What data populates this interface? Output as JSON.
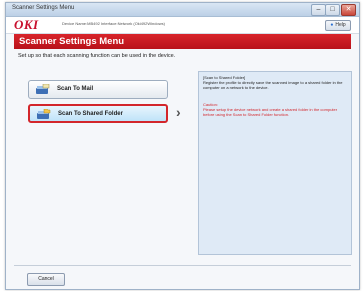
{
  "window": {
    "title": "Scanner Settings Menu",
    "minimize_glyph": "–",
    "maximize_glyph": "□",
    "close_glyph": "✕"
  },
  "header": {
    "logo": "OKI",
    "device_name": "Device Name:MB492 Interface:Network (Oki492Windows)",
    "help_label": "Help",
    "help_icon": "help-icon"
  },
  "menu_title": "Scanner Settings Menu",
  "intro": "Set up so that each scanning function can be used in the device.",
  "buttons": [
    {
      "label": "Scan To Mail",
      "icon": "scanner-mail-icon"
    },
    {
      "label": "Scan To Shared Folder",
      "icon": "scanner-folder-icon"
    }
  ],
  "arrow_glyph": "›",
  "info": {
    "title": "[Scan to Shared Folder]",
    "description": "Register the profile to directly save the scanned image to a shared folder in the computer on a network to the device.",
    "caution_label": "Caution:",
    "caution_text": "Please setup the device network and create a shared folder in the computer before using the Scan to Shared Folder function."
  },
  "footer": {
    "cancel_label": "Cancel"
  },
  "colors": {
    "brand_red": "#c8102e",
    "menu_red": "#d3262b",
    "panel_blue": "#dfeaf6"
  }
}
